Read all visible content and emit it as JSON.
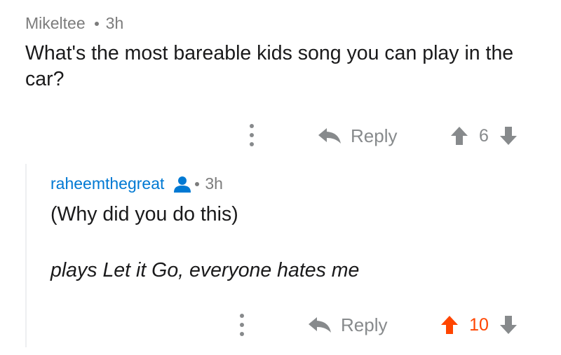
{
  "parent_comment": {
    "author": "Mikeltee",
    "age": "3h",
    "body": "What's the most bareable kids song you can play in the car?",
    "actions": {
      "more_icon": "kebab-vertical-icon",
      "reply_label": "Reply",
      "reply_icon": "reply-arrow-icon",
      "upvote_icon": "upvote-arrow-icon",
      "score": "6",
      "downvote_icon": "downvote-arrow-icon",
      "vote_state": "none"
    }
  },
  "reply_comment": {
    "author": "raheemthegreat",
    "author_badge_icon": "user-icon",
    "age": "3h",
    "body_line_1": "(Why did you do this)",
    "body_line_2": "plays Let it Go, everyone hates me",
    "actions": {
      "more_icon": "kebab-vertical-icon",
      "reply_label": "Reply",
      "reply_icon": "reply-arrow-icon",
      "upvote_icon": "upvote-arrow-icon",
      "score": "10",
      "downvote_icon": "downvote-arrow-icon",
      "vote_state": "upvoted"
    }
  },
  "colors": {
    "meta_gray": "#7c7c7c",
    "icon_gray": "#878a8c",
    "author_blue": "#0079d3",
    "upvote_orange": "#ff4500",
    "body_text": "#1a1a1b"
  }
}
